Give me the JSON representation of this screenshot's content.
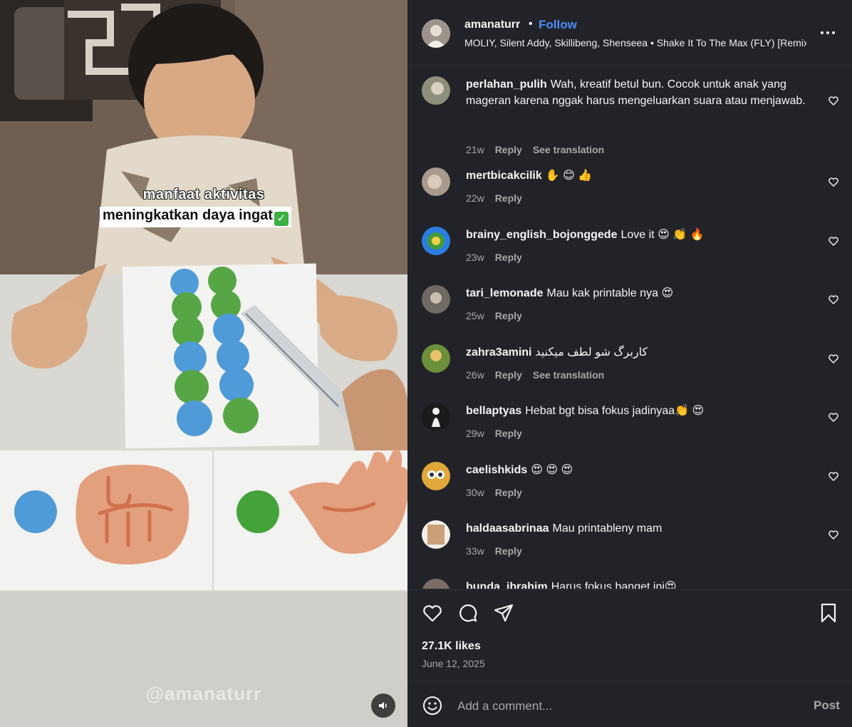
{
  "media": {
    "caption_line1": "manfaat aktivitas",
    "caption_line2": "meningkatkan daya ingat",
    "caption_check": "✓",
    "watermark": "@amanaturr",
    "mute_icon": "speaker-icon"
  },
  "header": {
    "username": "amanaturr",
    "separator": "•",
    "follow_label": "Follow",
    "audio": "MOLIY, Silent Addy, Skillibeng, Shenseea • Shake It To The Max (FLY) [Remix]",
    "more_icon": "more-options-icon"
  },
  "comments": [
    {
      "user": "perlahan_pulih",
      "text": "Wah, kreatif betul bun. Cocok untuk anak yang mageran karena nggak harus mengeluarkan suara atau menjawab.",
      "time": "21w",
      "reply": "Reply",
      "translate": "See translation",
      "avatar_color": "#8d8f7a"
    },
    {
      "user": "mertbicakcilik",
      "text": "✋ 😊 👍",
      "time": "22w",
      "reply": "Reply",
      "translate": "",
      "avatar_color": "#a89a8c"
    },
    {
      "user": "brainy_english_bojonggede",
      "text": "Love it 😍 👏 🔥",
      "time": "23w",
      "reply": "Reply",
      "translate": "",
      "avatar_color": "#2b7de0"
    },
    {
      "user": "tari_lemonade",
      "text": "Mau kak printable nya 😍",
      "time": "25w",
      "reply": "Reply",
      "translate": "",
      "avatar_color": "#6f6a62"
    },
    {
      "user": "zahra3amini",
      "text": "کاربرگ شو لطف میکنید",
      "time": "26w",
      "reply": "Reply",
      "translate": "See translation",
      "avatar_color": "#6c8f3a"
    },
    {
      "user": "bellaptyas",
      "text": "Hebat bgt bisa fokus jadinyaa👏 😍",
      "time": "29w",
      "reply": "Reply",
      "translate": "",
      "avatar_color": "#1b1b1b"
    },
    {
      "user": "caelishkids",
      "text": "😍 😍 😍",
      "time": "30w",
      "reply": "Reply",
      "translate": "",
      "avatar_color": "#e0a83a"
    },
    {
      "user": "haldaasabrinaa",
      "text": "Mau printableny mam",
      "time": "33w",
      "reply": "Reply",
      "translate": "",
      "avatar_color": "#c9a27a"
    },
    {
      "user": "bunda_ibrahim",
      "text": "Harus fokus banget ini😍",
      "time": "",
      "reply": "",
      "translate": "",
      "avatar_color": "#7a6d66"
    }
  ],
  "actions": {
    "like_icon": "heart-icon",
    "comment_icon": "comment-icon",
    "share_icon": "share-icon",
    "save_icon": "bookmark-icon",
    "likes": "27.1K likes",
    "date": "June 12, 2025",
    "add_placeholder": "Add a comment...",
    "post_label": "Post",
    "emoji_icon": "emoji-icon"
  },
  "colors": {
    "panel_bg": "#212328",
    "follow_blue": "#4a8df8",
    "muted_text": "#a8a8a8"
  }
}
